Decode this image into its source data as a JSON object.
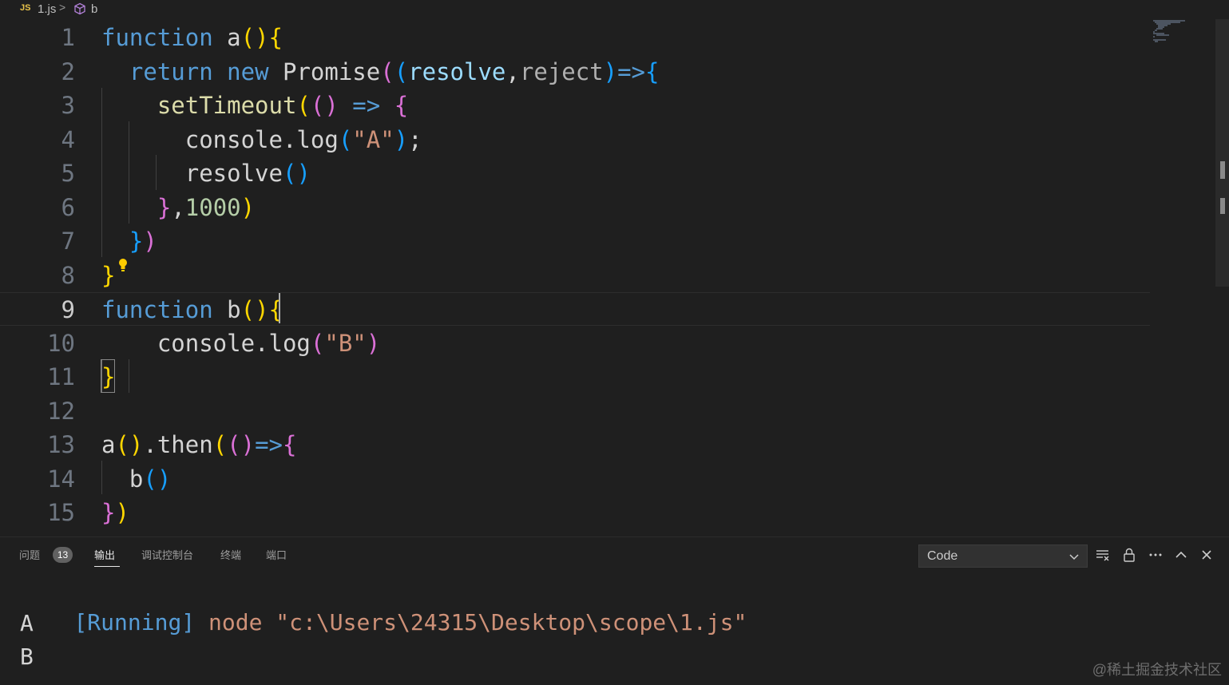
{
  "breadcrumb": {
    "lang_badge": "JS",
    "file": "1.js",
    "separator": ">",
    "symbol": "b"
  },
  "editor": {
    "cursor_line": 9,
    "lines": [
      {
        "n": "1",
        "tokens": [
          [
            "kw",
            "function"
          ],
          [
            "id",
            " a"
          ],
          [
            "b1",
            "()"
          ],
          [
            "b1",
            "{"
          ]
        ]
      },
      {
        "n": "2",
        "tokens": [
          [
            "id",
            "  "
          ],
          [
            "kw",
            "return"
          ],
          [
            "id",
            " "
          ],
          [
            "kw",
            "new"
          ],
          [
            "id",
            " Promise"
          ],
          [
            "b2",
            "("
          ],
          [
            "b3",
            "("
          ],
          [
            "pr",
            "resolve"
          ],
          [
            "id",
            ","
          ],
          [
            "un",
            "reject"
          ],
          [
            "b3",
            ")"
          ],
          [
            "op",
            "=>"
          ],
          [
            "b3",
            "{"
          ]
        ]
      },
      {
        "n": "3",
        "tokens": [
          [
            "id",
            "    "
          ],
          [
            "fn",
            "setTimeout"
          ],
          [
            "b1",
            "("
          ],
          [
            "b2",
            "()"
          ],
          [
            "op",
            " =>"
          ],
          [
            "id",
            " "
          ],
          [
            "b2",
            "{"
          ]
        ]
      },
      {
        "n": "4",
        "tokens": [
          [
            "id",
            "      console.log"
          ],
          [
            "b3",
            "("
          ],
          [
            "st",
            "\"A\""
          ],
          [
            "b3",
            ")"
          ],
          [
            "id",
            ";"
          ]
        ]
      },
      {
        "n": "5",
        "tokens": [
          [
            "id",
            "      resolve"
          ],
          [
            "b3",
            "()"
          ]
        ]
      },
      {
        "n": "6",
        "tokens": [
          [
            "id",
            "    "
          ],
          [
            "b2",
            "}"
          ],
          [
            "id",
            ","
          ],
          [
            "nm",
            "1000"
          ],
          [
            "b1",
            ")"
          ]
        ]
      },
      {
        "n": "7",
        "tokens": [
          [
            "id",
            "  "
          ],
          [
            "b3",
            "}"
          ],
          [
            "b2",
            ")"
          ]
        ]
      },
      {
        "n": "8",
        "tokens": [
          [
            "b1",
            "}"
          ]
        ]
      },
      {
        "n": "9",
        "tokens": [
          [
            "kw",
            "function"
          ],
          [
            "id",
            " b"
          ],
          [
            "b1",
            "()"
          ],
          [
            "b1",
            "{"
          ]
        ]
      },
      {
        "n": "10",
        "tokens": [
          [
            "id",
            "    console.log"
          ],
          [
            "b2",
            "("
          ],
          [
            "st",
            "\"B\""
          ],
          [
            "b2",
            ")"
          ]
        ]
      },
      {
        "n": "11",
        "tokens": [
          [
            "b1",
            "}"
          ]
        ]
      },
      {
        "n": "12",
        "tokens": []
      },
      {
        "n": "13",
        "tokens": [
          [
            "id",
            "a"
          ],
          [
            "b1",
            "()"
          ],
          [
            "id",
            ".then"
          ],
          [
            "b1",
            "("
          ],
          [
            "b2",
            "()"
          ],
          [
            "op",
            "=>"
          ],
          [
            "b2",
            "{"
          ]
        ]
      },
      {
        "n": "14",
        "tokens": [
          [
            "id",
            "  b"
          ],
          [
            "b3",
            "()"
          ]
        ]
      },
      {
        "n": "15",
        "tokens": [
          [
            "b2",
            "}"
          ],
          [
            "b1",
            ")"
          ]
        ]
      }
    ]
  },
  "panel": {
    "tabs": [
      {
        "label": "问题",
        "badge": "13"
      },
      {
        "label": "输出"
      },
      {
        "label": "调试控制台"
      },
      {
        "label": "终端"
      },
      {
        "label": "端口"
      }
    ],
    "active_tab": "输出",
    "channel_select": "Code",
    "icons": [
      "clear-output-icon",
      "lock-scroll-icon",
      "more-actions-icon",
      "maximize-panel-icon",
      "close-panel-icon"
    ],
    "output": {
      "running_tag": "[Running]",
      "command": " node \"c:\\Users\\24315\\Desktop\\scope\\1.js\"",
      "lines": [
        "A",
        "B"
      ]
    }
  },
  "watermark": "@稀土掘金技术社区",
  "colors": {
    "background": "#1f1f1f",
    "keyword": "#569cd6",
    "string": "#ce9178",
    "number": "#b5cea8",
    "bracket_gold": "#ffd700",
    "bracket_orchid": "#da70d6",
    "bracket_blue": "#179fff"
  }
}
